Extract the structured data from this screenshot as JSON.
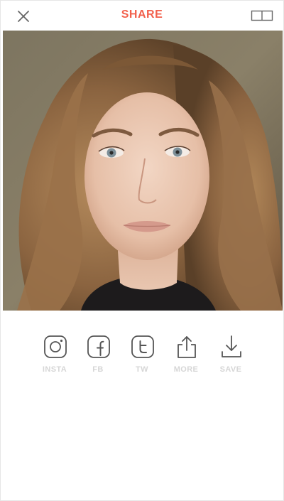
{
  "header": {
    "title": "SHARE",
    "close_icon": "close-icon",
    "layout_icon": "split-layout-icon",
    "accent_color": "#f2604c"
  },
  "photo": {
    "subject": "portrait-photo"
  },
  "share_options": [
    {
      "icon": "instagram-icon",
      "label": "INSTA"
    },
    {
      "icon": "facebook-icon",
      "label": "FB"
    },
    {
      "icon": "twitter-icon",
      "label": "TW"
    },
    {
      "icon": "share-upload-icon",
      "label": "MORE"
    },
    {
      "icon": "download-icon",
      "label": "SAVE"
    }
  ],
  "colors": {
    "icon_stroke": "#555555",
    "label_color": "#d6d6d6"
  }
}
